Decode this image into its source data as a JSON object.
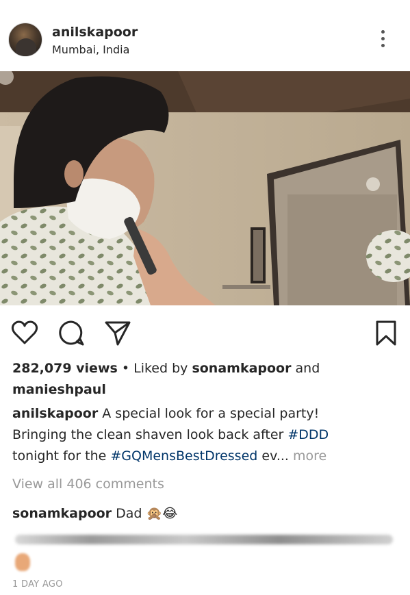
{
  "post": {
    "username": "anilskapoor",
    "location": "Mumbai, India",
    "views": "282,079 views",
    "separator": " • ",
    "liked_by_prefix": "Liked by ",
    "liked_by_user": "sonamkapoor",
    "liked_by_and": " and",
    "liked_by_user2": "manieshpaul",
    "caption_user": "anilskapoor",
    "caption_line1": " A special look for a special party!",
    "caption_line2_text": "Bringing the clean shaven look back after ",
    "caption_hashtag1": "#DDD",
    "caption_line3_text": "tonight for the ",
    "caption_hashtag2": "#GQMensBestDressed",
    "caption_truncated": " ev...",
    "more_label": " more",
    "view_comments": "View all 406 comments",
    "comment_user": "sonamkapoor",
    "comment_text": " Dad 🙊😂",
    "timestamp": "1 DAY AGO"
  },
  "icons": {
    "avatar": "profile-photo",
    "more": "vertical-ellipsis-icon",
    "like": "heart-icon",
    "comment": "comment-bubble-icon",
    "share": "paper-plane-icon",
    "save": "bookmark-icon"
  },
  "colors": {
    "text": "#262626",
    "hashtag": "#003569",
    "muted": "#999999",
    "background": "#ffffff"
  }
}
